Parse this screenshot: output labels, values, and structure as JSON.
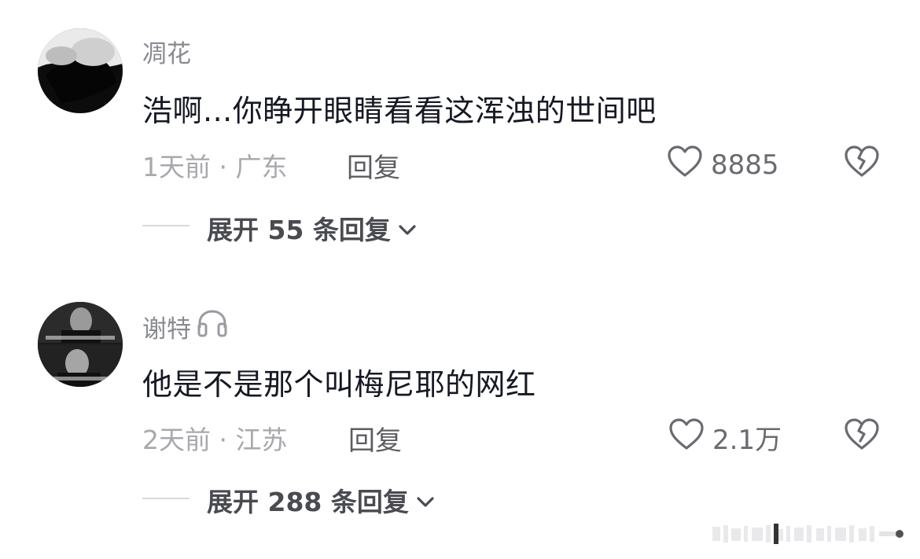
{
  "comments": [
    {
      "username": "凋花",
      "text": "浩啊...你睁开眼睛看看这浑浊的世间吧",
      "meta": "1天前 · 广东",
      "reply_label": "回复",
      "like_count": "8885",
      "expand_label": "展开 55 条回复"
    },
    {
      "username": "谢特",
      "username_icon": "headphones-icon",
      "text": "他是不是那个叫梅尼耶的网红",
      "meta": "2天前 · 江苏",
      "reply_label": "回复",
      "like_count": "2.1万",
      "expand_label": "展开 288 条回复"
    }
  ],
  "icons": [
    "heart-icon",
    "broken-heart-icon",
    "chevron-down-icon"
  ],
  "colors": {
    "text": "#161823",
    "secondary": "#8a8b91",
    "background": "#ffffff"
  }
}
